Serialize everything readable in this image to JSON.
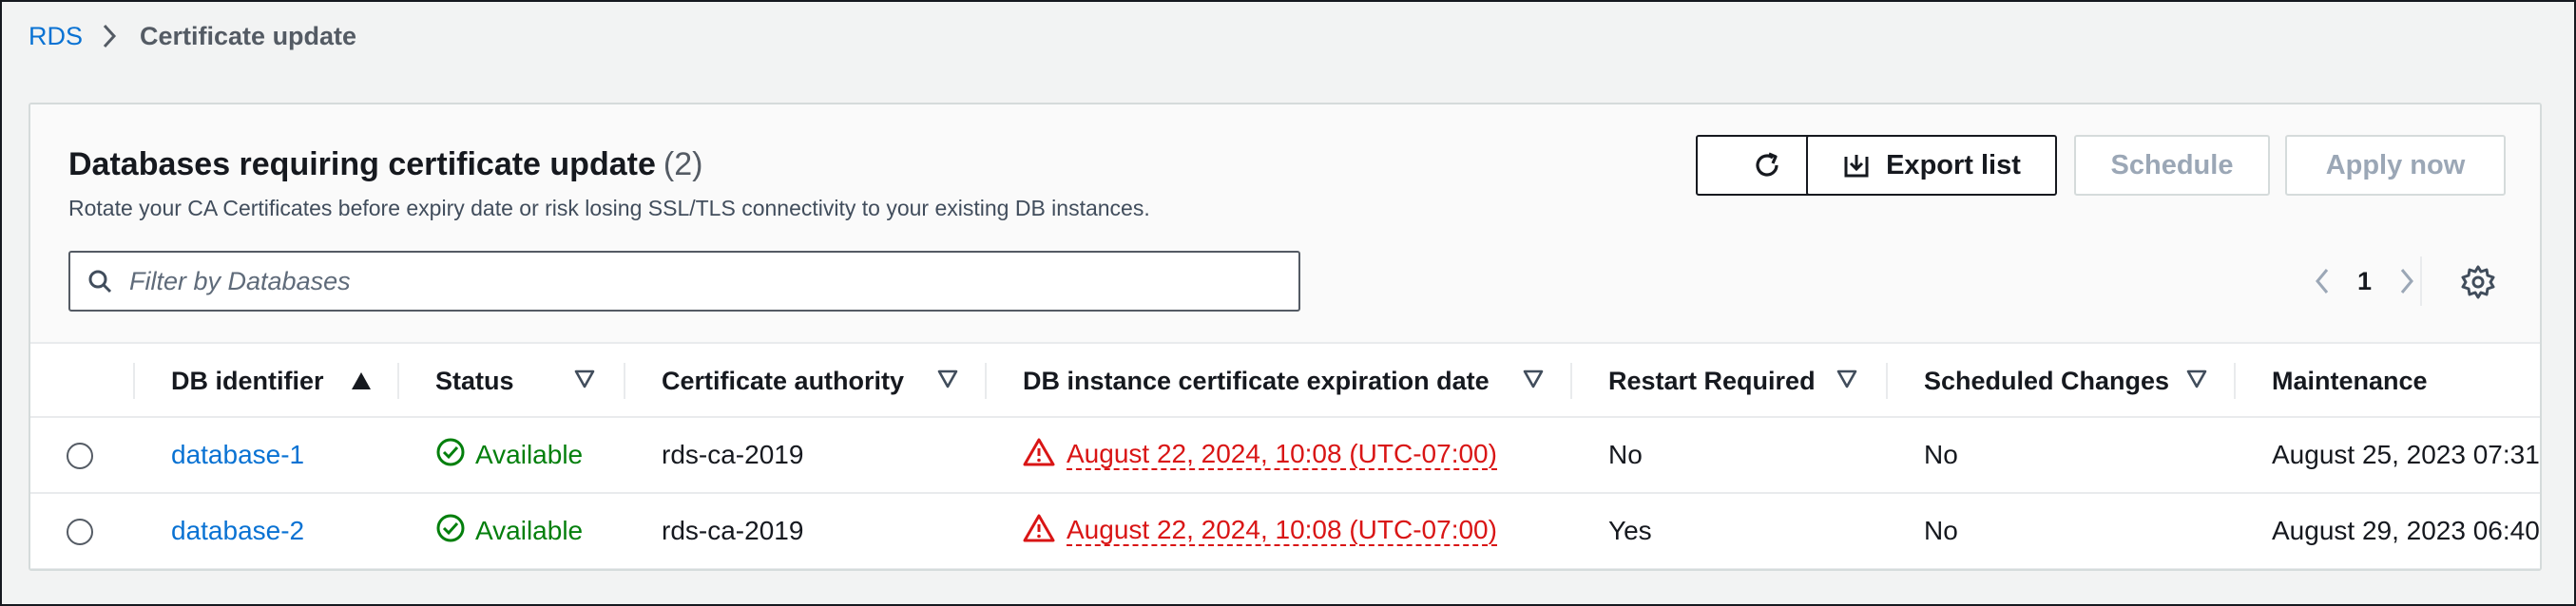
{
  "breadcrumb": {
    "root": "RDS",
    "current": "Certificate update"
  },
  "panel": {
    "title": "Databases requiring certificate update",
    "count": "(2)",
    "description": "Rotate your CA Certificates before expiry date or risk losing SSL/TLS connectivity to your existing DB instances."
  },
  "actions": {
    "refresh_icon": "refresh-icon",
    "export_label": "Export list",
    "export_icon": "download-icon",
    "schedule_label": "Schedule",
    "apply_label": "Apply now"
  },
  "filter": {
    "placeholder": "Filter by Databases",
    "value": ""
  },
  "pagination": {
    "current_page": "1"
  },
  "table": {
    "columns": [
      {
        "label": "DB identifier",
        "sort": "ascending"
      },
      {
        "label": "Status",
        "sort": "none"
      },
      {
        "label": "Certificate authority",
        "sort": "none"
      },
      {
        "label": "DB instance certificate expiration date",
        "sort": "none"
      },
      {
        "label": "Restart Required",
        "sort": "none"
      },
      {
        "label": "Scheduled Changes",
        "sort": "none"
      },
      {
        "label": "Maintenance",
        "sort": "none"
      }
    ],
    "rows": [
      {
        "id": "database-1",
        "status": "Available",
        "ca": "rds-ca-2019",
        "expiration": "August 22, 2024, 10:08 (UTC-07:00)",
        "restart": "No",
        "scheduled": "No",
        "maintenance": "August 25, 2023 07:31"
      },
      {
        "id": "database-2",
        "status": "Available",
        "ca": "rds-ca-2019",
        "expiration": "August 22, 2024, 10:08 (UTC-07:00)",
        "restart": "Yes",
        "scheduled": "No",
        "maintenance": "August 29, 2023 06:40"
      }
    ]
  },
  "colors": {
    "link": "#0972d3",
    "success": "#037f0c",
    "error": "#d91515",
    "disabled": "#9ba7b6"
  }
}
